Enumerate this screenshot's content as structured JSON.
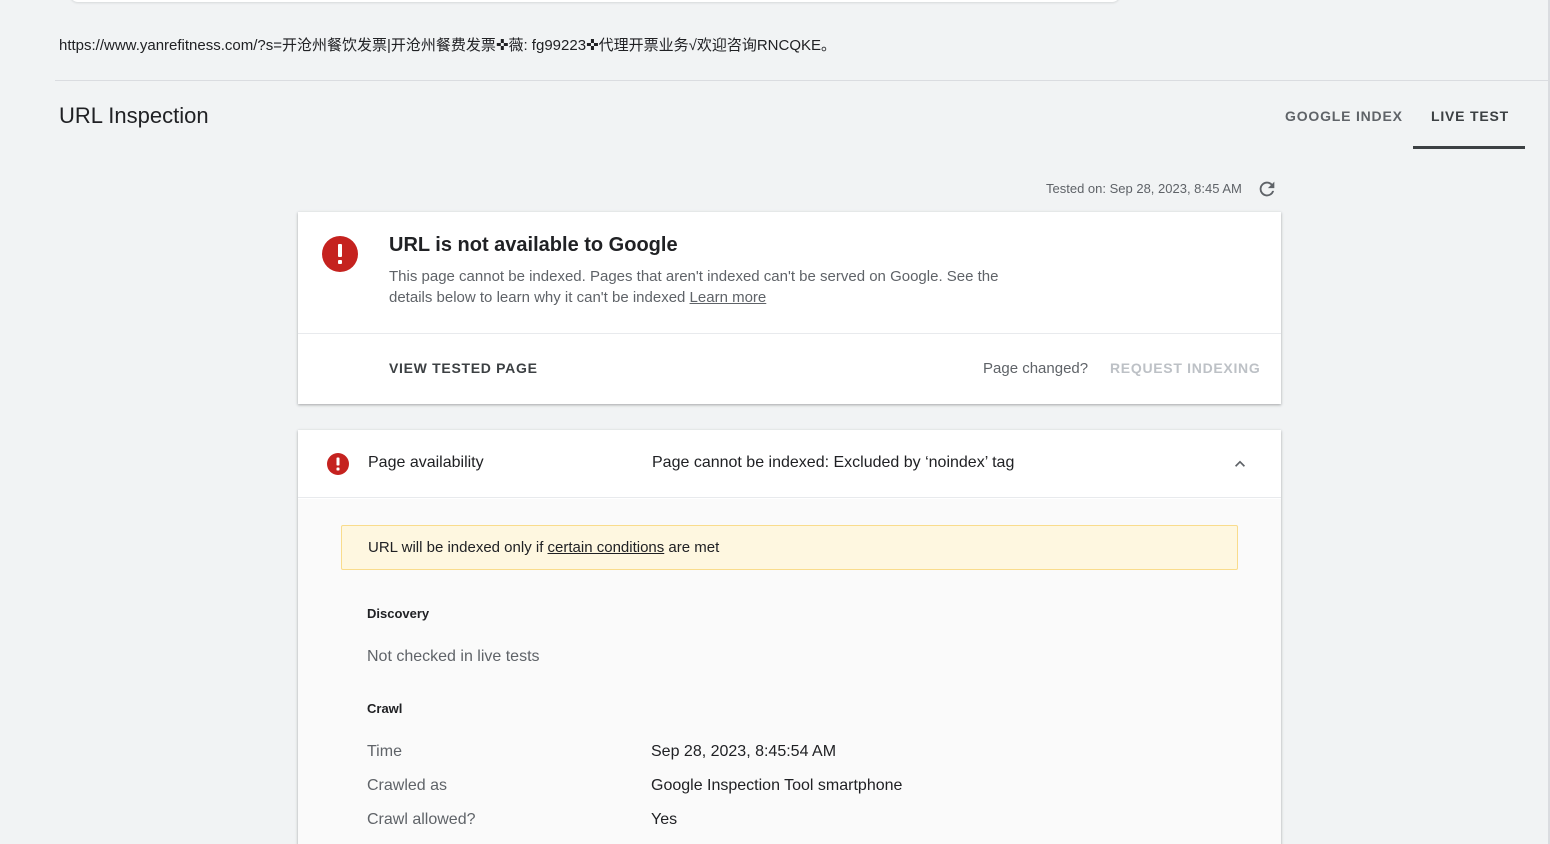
{
  "header": {
    "url": "https://www.yanrefitness.com/?s=开沧州餐饮发票|开沧州餐费发票✜薇: fg99223✜代理开票业务√欢迎咨询RNCQKE。",
    "title": "URL Inspection",
    "tabs": [
      {
        "label": "GOOGLE INDEX",
        "active": false
      },
      {
        "label": "LIVE TEST",
        "active": true
      }
    ]
  },
  "test_info": {
    "tested_on": "Tested on: Sep 28, 2023, 8:45 AM",
    "refresh_icon": "refresh-icon"
  },
  "status_card": {
    "icon": "error-icon",
    "title": "URL is not available to Google",
    "description": "This page cannot be indexed. Pages that aren't indexed can't be served on Google. See the details below to learn why it can't be indexed",
    "learn_more": "Learn more",
    "view_tested_page": "VIEW TESTED PAGE",
    "page_changed": "Page changed?",
    "request_indexing": "REQUEST INDEXING"
  },
  "availability": {
    "icon": "error-icon",
    "label": "Page availability",
    "value": "Page cannot be indexed: Excluded by ‘noindex’ tag",
    "expand_icon": "chevron-up-icon",
    "banner": {
      "prefix": "URL will be indexed only if ",
      "link": "certain conditions",
      "suffix": " are met"
    },
    "discovery": {
      "heading": "Discovery",
      "text": "Not checked in live tests"
    },
    "crawl": {
      "heading": "Crawl",
      "rows": [
        {
          "label": "Time",
          "value": "Sep 28, 2023, 8:45:54 AM"
        },
        {
          "label": "Crawled as",
          "value": "Google Inspection Tool smartphone"
        },
        {
          "label": "Crawl allowed?",
          "value": "Yes"
        }
      ]
    }
  },
  "colors": {
    "error": "#c5221f",
    "warning_bg": "#fef7e0",
    "warning_border": "#f9dc8c",
    "active_tab": "#3c4043"
  }
}
